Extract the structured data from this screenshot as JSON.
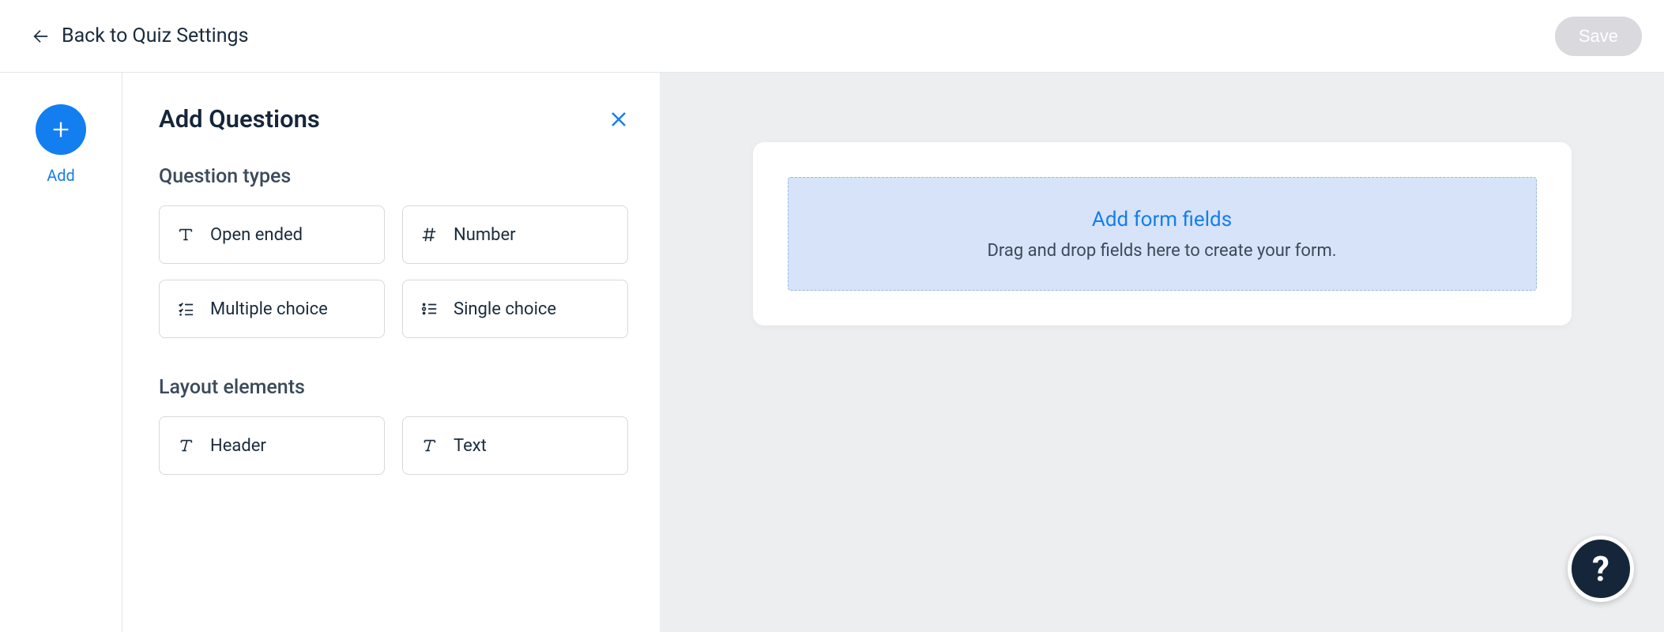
{
  "header": {
    "back_label": "Back to Quiz Settings",
    "save_label": "Save"
  },
  "rail": {
    "add_label": "Add"
  },
  "panel": {
    "title": "Add Questions",
    "sections": {
      "question_types": {
        "title": "Question types",
        "items": [
          {
            "label": "Open ended",
            "icon": "text-t-icon"
          },
          {
            "label": "Number",
            "icon": "hash-icon"
          },
          {
            "label": "Multiple choice",
            "icon": "checklist-icon"
          },
          {
            "label": "Single choice",
            "icon": "radiolist-icon"
          }
        ]
      },
      "layout_elements": {
        "title": "Layout elements",
        "items": [
          {
            "label": "Header",
            "icon": "italic-t-icon"
          },
          {
            "label": "Text",
            "icon": "italic-t-icon"
          }
        ]
      }
    }
  },
  "canvas": {
    "dropzone": {
      "title": "Add form fields",
      "subtitle": "Drag and drop fields here to create your form."
    }
  },
  "help": {
    "label": "?"
  },
  "colors": {
    "accent": "#137ef0",
    "dark": "#15263a",
    "panel_bg": "#eceef0",
    "dropzone_bg": "#d7e3f8"
  }
}
